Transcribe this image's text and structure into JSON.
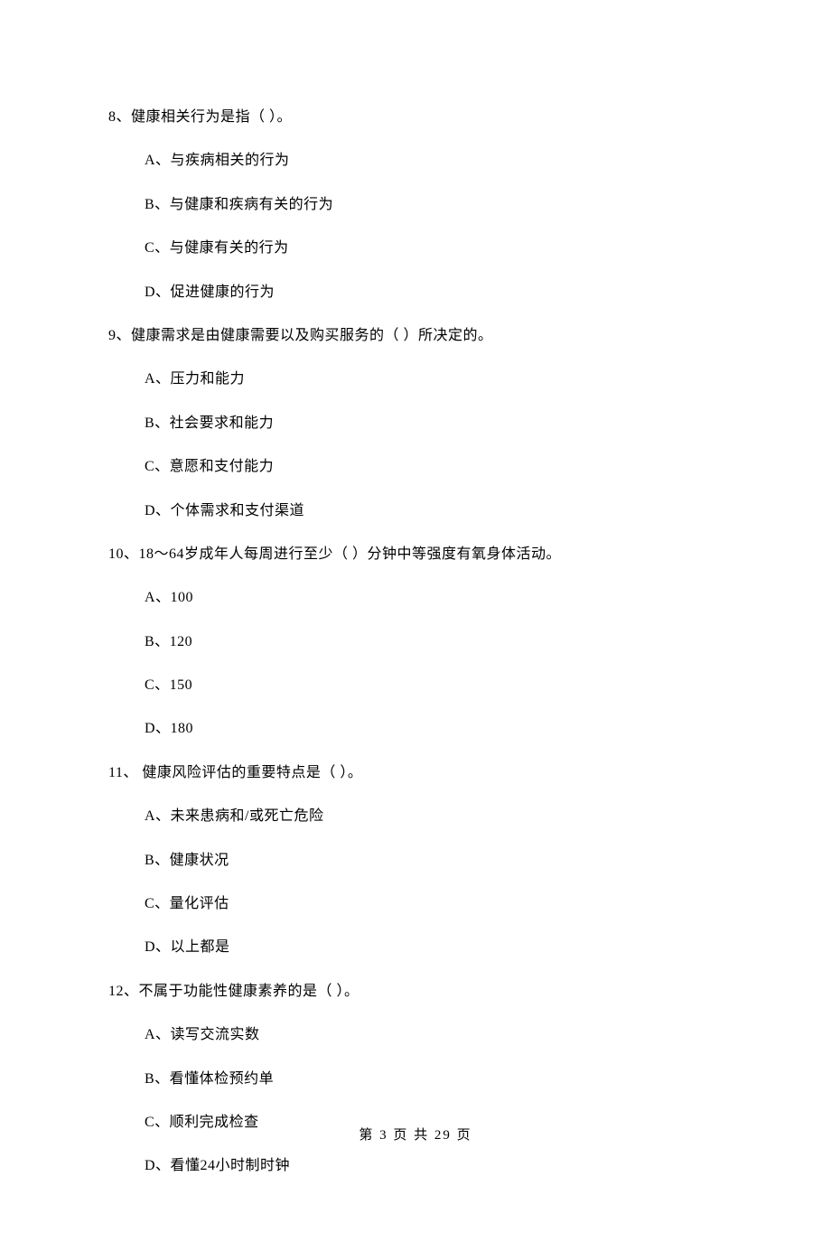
{
  "questions": [
    {
      "num": "8、",
      "stem": "健康相关行为是指（     ）。",
      "options": [
        "A、与疾病相关的行为",
        "B、与健康和疾病有关的行为",
        "C、与健康有关的行为",
        "D、促进健康的行为"
      ]
    },
    {
      "num": "9、",
      "stem": "健康需求是由健康需要以及购买服务的（    ）所决定的。",
      "options": [
        "A、压力和能力",
        "B、社会要求和能力",
        "C、意愿和支付能力",
        "D、个体需求和支付渠道"
      ]
    },
    {
      "num": "10、",
      "stem": "18～64岁成年人每周进行至少（    ）分钟中等强度有氧身体活动。",
      "options": [
        "A、100",
        "B、120",
        "C、150",
        "D、180"
      ]
    },
    {
      "num": "11、",
      "stem": " 健康风险评估的重要特点是（    ）。",
      "options": [
        "A、未来患病和/或死亡危险",
        "B、健康状况",
        "C、量化评估",
        "D、以上都是"
      ]
    },
    {
      "num": "12、",
      "stem": "不属于功能性健康素养的是（     ）。",
      "options": [
        "A、读写交流实数",
        "B、看懂体检预约单",
        "C、顺利完成检查",
        "D、看懂24小时制时钟"
      ]
    }
  ],
  "footer": "第 3 页 共 29 页"
}
